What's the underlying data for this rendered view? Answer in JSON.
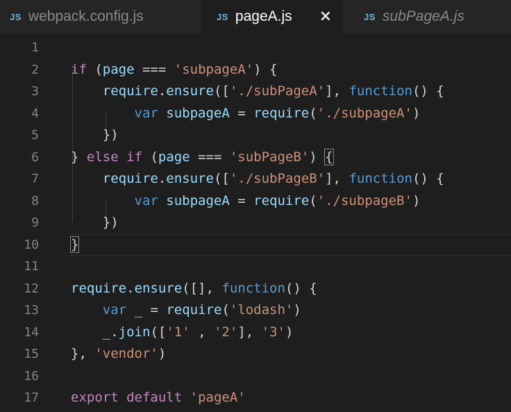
{
  "tabs": [
    {
      "icon": "JS",
      "label": "webpack.config.js",
      "active": false,
      "italic": false
    },
    {
      "icon": "JS",
      "label": "pageA.js",
      "active": true,
      "italic": false,
      "close": "×"
    },
    {
      "icon": "JS",
      "label": "subPageA.js",
      "active": false,
      "italic": true
    }
  ],
  "colors": {
    "background": "#1e1e1e",
    "tabbar": "#252526",
    "keyword": "#c586c0",
    "storage": "#569cd6",
    "string": "#ce9178",
    "identifier": "#9cdcfe",
    "plain": "#d4d4d4",
    "line_number": "#858585"
  },
  "editor": {
    "lines": [
      {
        "n": "1",
        "t": []
      },
      {
        "n": "2",
        "t": [
          [
            "kw",
            "if"
          ],
          [
            "pn",
            " ("
          ],
          [
            "id",
            "page"
          ],
          [
            "pn",
            " === "
          ],
          [
            "str",
            "'subpageA'"
          ],
          [
            "pn",
            ") {"
          ]
        ]
      },
      {
        "n": "3",
        "t": [
          [
            "pn",
            "    "
          ],
          [
            "id",
            "require"
          ],
          [
            "pn",
            "."
          ],
          [
            "id",
            "ensure"
          ],
          [
            "pn",
            "(["
          ],
          [
            "str",
            "'./subPageA'"
          ],
          [
            "pn",
            "], "
          ],
          [
            "kb",
            "function"
          ],
          [
            "pn",
            "() {"
          ]
        ]
      },
      {
        "n": "4",
        "t": [
          [
            "pn",
            "        "
          ],
          [
            "kb",
            "var"
          ],
          [
            "pn",
            " "
          ],
          [
            "id",
            "subpageA"
          ],
          [
            "pn",
            " = "
          ],
          [
            "id",
            "require"
          ],
          [
            "pn",
            "("
          ],
          [
            "str",
            "'./subpageA'"
          ],
          [
            "pn",
            ")"
          ]
        ]
      },
      {
        "n": "5",
        "t": [
          [
            "pn",
            "    })"
          ]
        ]
      },
      {
        "n": "6",
        "t": [
          [
            "pn",
            "} "
          ],
          [
            "kw",
            "else"
          ],
          [
            "pn",
            " "
          ],
          [
            "kw",
            "if"
          ],
          [
            "pn",
            " ("
          ],
          [
            "id",
            "page"
          ],
          [
            "pn",
            " === "
          ],
          [
            "str",
            "'subPageB'"
          ],
          [
            "pn",
            ") "
          ],
          [
            "pn",
            "{"
          ]
        ]
      },
      {
        "n": "7",
        "t": [
          [
            "pn",
            "    "
          ],
          [
            "id",
            "require"
          ],
          [
            "pn",
            "."
          ],
          [
            "id",
            "ensure"
          ],
          [
            "pn",
            "(["
          ],
          [
            "str",
            "'./subPageB'"
          ],
          [
            "pn",
            "], "
          ],
          [
            "kb",
            "function"
          ],
          [
            "pn",
            "() {"
          ]
        ]
      },
      {
        "n": "8",
        "t": [
          [
            "pn",
            "        "
          ],
          [
            "kb",
            "var"
          ],
          [
            "pn",
            " "
          ],
          [
            "id",
            "subpageA"
          ],
          [
            "pn",
            " = "
          ],
          [
            "id",
            "require"
          ],
          [
            "pn",
            "("
          ],
          [
            "str",
            "'./subpageB'"
          ],
          [
            "pn",
            ")"
          ]
        ]
      },
      {
        "n": "9",
        "t": [
          [
            "pn",
            "    })"
          ]
        ]
      },
      {
        "n": "10",
        "t": [
          [
            "pn",
            "}"
          ]
        ]
      },
      {
        "n": "11",
        "t": []
      },
      {
        "n": "12",
        "t": [
          [
            "id",
            "require"
          ],
          [
            "pn",
            "."
          ],
          [
            "id",
            "ensure"
          ],
          [
            "pn",
            "([], "
          ],
          [
            "kb",
            "function"
          ],
          [
            "pn",
            "() {"
          ]
        ]
      },
      {
        "n": "13",
        "t": [
          [
            "pn",
            "    "
          ],
          [
            "kb",
            "var"
          ],
          [
            "pn",
            " "
          ],
          [
            "id",
            "_"
          ],
          [
            "pn",
            " = "
          ],
          [
            "id",
            "require"
          ],
          [
            "pn",
            "("
          ],
          [
            "str",
            "'lodash'"
          ],
          [
            "pn",
            ")"
          ]
        ]
      },
      {
        "n": "14",
        "t": [
          [
            "pn",
            "    "
          ],
          [
            "id",
            "_"
          ],
          [
            "pn",
            "."
          ],
          [
            "id",
            "join"
          ],
          [
            "pn",
            "(["
          ],
          [
            "str",
            "'1'"
          ],
          [
            "pn",
            " , "
          ],
          [
            "str",
            "'2'"
          ],
          [
            "pn",
            "], "
          ],
          [
            "str",
            "'3'"
          ],
          [
            "pn",
            ")"
          ]
        ]
      },
      {
        "n": "15",
        "t": [
          [
            "pn",
            "}, "
          ],
          [
            "str",
            "'vendor'"
          ],
          [
            "pn",
            ")"
          ]
        ]
      },
      {
        "n": "16",
        "t": []
      },
      {
        "n": "17",
        "t": [
          [
            "kw",
            "export"
          ],
          [
            "pn",
            " "
          ],
          [
            "kw",
            "default"
          ],
          [
            "pn",
            " "
          ],
          [
            "str",
            "'pageA'"
          ]
        ]
      }
    ],
    "current_line": "10",
    "bracket_match": [
      "6",
      "10"
    ]
  }
}
